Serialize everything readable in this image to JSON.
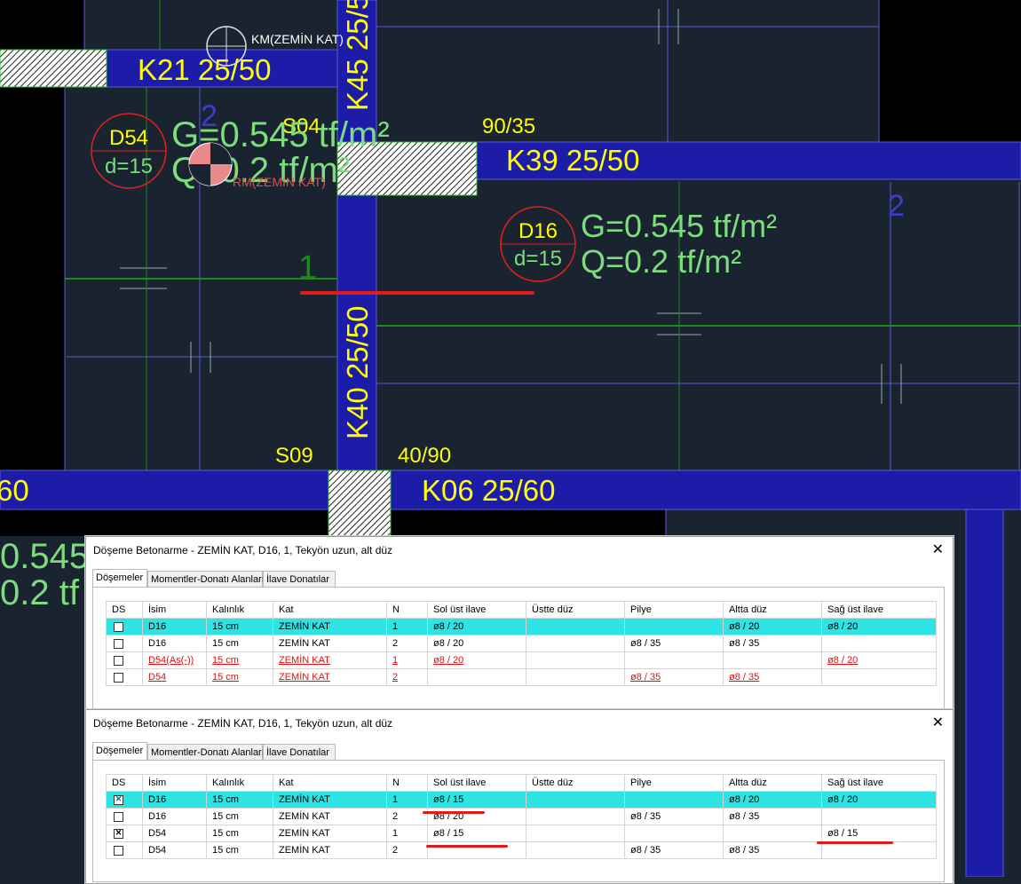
{
  "cad": {
    "beam_labels": [
      "K21 25/50",
      "K45 25/5",
      "K39 25/50",
      "K40 25/50",
      "K06 25/60",
      "60"
    ],
    "column_labels": [
      "S04",
      "90/35",
      "S09",
      "40/90"
    ],
    "slab_D54": {
      "name": "D54",
      "thickness": "d=15",
      "G": "G=0.545 tf/m²",
      "Q": "Q=0.2 tf/m²"
    },
    "slab_D16": {
      "name": "D16",
      "thickness": "d=15",
      "G": "G=0.545 tf/m²",
      "Q": "Q=0.2 tf/m²"
    },
    "marker_top": "KM(ZEMİN KAT)",
    "marker_mid": "RM(ZEMİN KAT)",
    "axis_labels": [
      "1",
      "2",
      "2"
    ],
    "left_values": [
      "0.545",
      "0.2 tf"
    ],
    "colors": {
      "beam": "#1c1ca8",
      "beam_label": "#ffff00",
      "load_text": "#7ddc7d",
      "slab_bubble": "#e02020",
      "grid_green": "#1e8a1e",
      "panel_bg": "#1a2430"
    }
  },
  "dialog1": {
    "title": "Döşeme Betonarme - ZEMİN KAT, D16, 1, Tekyön uzun, alt düz",
    "close": "✕",
    "tabs": [
      "Döşemeler",
      "Momentler-Donatı Alanları",
      "İlave Donatılar"
    ],
    "columns": [
      "DS",
      "İsim",
      "Kalınlık",
      "Kat",
      "N",
      "Sol üst ilave",
      "Üstte düz",
      "Pilye",
      "Altta düz",
      "Sağ üst ilave"
    ],
    "rows": [
      {
        "checked": false,
        "style": "sel",
        "cells": [
          "D16",
          "15 cm",
          "ZEMİN KAT",
          "1",
          "ø8 / 20",
          "",
          "",
          "ø8 / 20",
          "ø8 / 20"
        ]
      },
      {
        "checked": false,
        "style": "",
        "cells": [
          "D16",
          "15 cm",
          "ZEMİN KAT",
          "2",
          "ø8 / 20",
          "",
          "ø8 / 35",
          "ø8 / 35",
          ""
        ]
      },
      {
        "checked": false,
        "style": "err",
        "cells": [
          "D54(As(-))",
          "15 cm",
          "ZEMİN KAT",
          "1",
          "ø8 / 20",
          "",
          "",
          "",
          "ø8 / 20"
        ]
      },
      {
        "checked": false,
        "style": "err",
        "cells": [
          "D54",
          "15 cm",
          "ZEMİN KAT",
          "2",
          "",
          "",
          "ø8 / 35",
          "ø8 / 35",
          ""
        ]
      }
    ]
  },
  "dialog2": {
    "title": "Döşeme Betonarme - ZEMİN KAT, D16, 1, Tekyön uzun, alt düz",
    "close": "✕",
    "tabs": [
      "Döşemeler",
      "Momentler-Donatı Alanları",
      "İlave Donatılar"
    ],
    "columns": [
      "DS",
      "İsim",
      "Kalınlık",
      "Kat",
      "N",
      "Sol üst ilave",
      "Üstte düz",
      "Pilye",
      "Altta düz",
      "Sağ üst ilave"
    ],
    "rows": [
      {
        "checked": true,
        "style": "sel",
        "cells": [
          "D16",
          "15 cm",
          "ZEMİN KAT",
          "1",
          "ø8 / 15",
          "",
          "",
          "ø8 / 20",
          "ø8 / 20"
        ]
      },
      {
        "checked": false,
        "style": "",
        "cells": [
          "D16",
          "15 cm",
          "ZEMİN KAT",
          "2",
          "ø8 / 20",
          "",
          "ø8 / 35",
          "ø8 / 35",
          ""
        ]
      },
      {
        "checked": true,
        "style": "",
        "cells": [
          "D54",
          "15 cm",
          "ZEMİN KAT",
          "1",
          "ø8 / 15",
          "",
          "",
          "",
          "ø8 / 15"
        ]
      },
      {
        "checked": false,
        "style": "",
        "cells": [
          "D54",
          "15 cm",
          "ZEMİN KAT",
          "2",
          "",
          "",
          "ø8 / 35",
          "ø8 / 35",
          ""
        ]
      }
    ]
  }
}
